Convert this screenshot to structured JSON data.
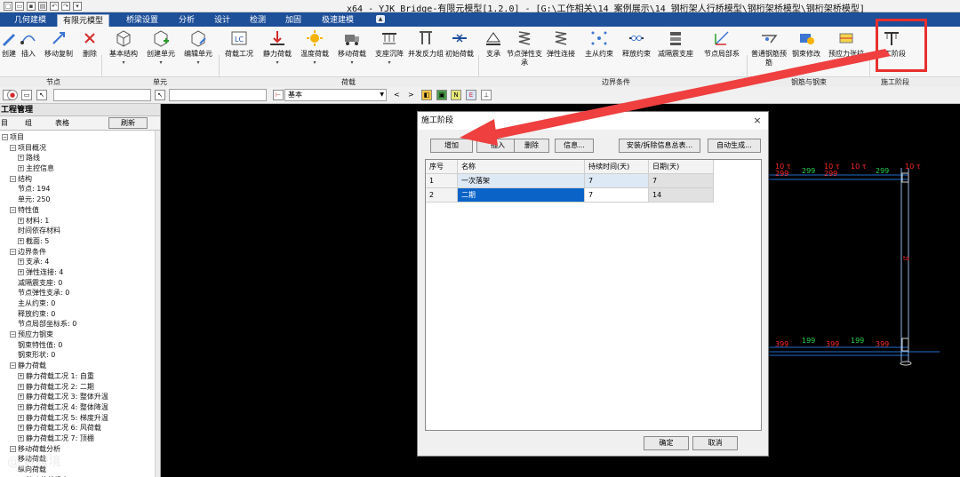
{
  "window": {
    "title": "x64 - YJK Bridge-有限元模型[1.2.0] - [G:\\工作相关\\14 案例展示\\14 钢桁架人行桥模型\\钢桁架桥模型\\钢桁架桥模型]"
  },
  "ribbon_tabs": [
    "几何建模",
    "有限元模型",
    "桥梁设置",
    "分析",
    "设计",
    "检测",
    "加固",
    "极速建模"
  ],
  "active_tab": "有限元模型",
  "ribbon": {
    "buttons": [
      {
        "label": "创建",
        "icon": "pencil-icon"
      },
      {
        "label": "插入",
        "icon": "node-insert-icon"
      },
      {
        "label": "移动复制",
        "icon": "move-copy-icon"
      },
      {
        "label": "删除",
        "icon": "delete-icon"
      },
      {
        "label": "基本结构",
        "icon": "cube-icon"
      },
      {
        "label": "创建单元",
        "icon": "cube-plus-icon"
      },
      {
        "label": "编辑单元",
        "icon": "cube-edit-icon"
      },
      {
        "label": "荷载工况",
        "icon": "lc-icon"
      },
      {
        "label": "静力荷载",
        "icon": "static-load-icon"
      },
      {
        "label": "温度荷载",
        "icon": "temperature-icon"
      },
      {
        "label": "移动荷载",
        "icon": "truck-icon"
      },
      {
        "label": "支座沉降",
        "icon": "support-settle-icon"
      },
      {
        "label": "并发反力组",
        "icon": "reaction-group-icon"
      },
      {
        "label": "初始荷载",
        "icon": "initial-load-icon"
      },
      {
        "label": "支承",
        "icon": "support-icon"
      },
      {
        "label": "节点弹性支承",
        "icon": "spring-icon"
      },
      {
        "label": "弹性连接",
        "icon": "elastic-link-icon"
      },
      {
        "label": "主从约束",
        "icon": "master-slave-icon"
      },
      {
        "label": "释放约束",
        "icon": "release-icon"
      },
      {
        "label": "减隔震支座",
        "icon": "isolator-icon"
      },
      {
        "label": "节点局部系",
        "icon": "local-axis-icon"
      },
      {
        "label": "普通钢筋预筋",
        "icon": "rebar-icon"
      },
      {
        "label": "钢束修改",
        "icon": "tendon-edit-icon"
      },
      {
        "label": "预应力张拉",
        "icon": "prestress-icon"
      },
      {
        "label": "施工阶段",
        "icon": "construction-stage-icon"
      }
    ],
    "groups": [
      "节点",
      "单元",
      "荷载",
      "边界条件",
      "钢筋与钢束",
      "施工阶段"
    ]
  },
  "toolbar": {
    "combo_value": "基本",
    "nav_prev": "<",
    "nav_next": ">"
  },
  "left_panel": {
    "title": "工程管理",
    "tabs": [
      "目",
      "组",
      "表格"
    ],
    "refresh_label": "刷新",
    "tree": [
      {
        "text": "项目",
        "level": 0,
        "box": "-"
      },
      {
        "text": "项目概况",
        "level": 1,
        "box": "-"
      },
      {
        "text": "路线",
        "level": 2,
        "box": "+"
      },
      {
        "text": "主控信息",
        "level": 2,
        "box": "+"
      },
      {
        "text": "结构",
        "level": 1,
        "box": "-"
      },
      {
        "text": "节点: 194",
        "level": 2,
        "box": ""
      },
      {
        "text": "单元: 250",
        "level": 2,
        "box": ""
      },
      {
        "text": "特性值",
        "level": 1,
        "box": "-"
      },
      {
        "text": "材料: 1",
        "level": 2,
        "box": "+"
      },
      {
        "text": "时间依存材料",
        "level": 2,
        "box": ""
      },
      {
        "text": "截面: 5",
        "level": 2,
        "box": "+"
      },
      {
        "text": "边界条件",
        "level": 1,
        "box": "-"
      },
      {
        "text": "支承: 4",
        "level": 2,
        "box": "+"
      },
      {
        "text": "弹性连接: 4",
        "level": 2,
        "box": "+"
      },
      {
        "text": "减隔震支座: 0",
        "level": 2,
        "box": ""
      },
      {
        "text": "节点弹性支承: 0",
        "level": 2,
        "box": ""
      },
      {
        "text": "主从约束: 0",
        "level": 2,
        "box": ""
      },
      {
        "text": "释放约束: 0",
        "level": 2,
        "box": ""
      },
      {
        "text": "节点局部坐标系: 0",
        "level": 2,
        "box": ""
      },
      {
        "text": "预应力钢束",
        "level": 1,
        "box": "-"
      },
      {
        "text": "钢束特性值: 0",
        "level": 2,
        "box": ""
      },
      {
        "text": "钢束形状: 0",
        "level": 2,
        "box": ""
      },
      {
        "text": "静力荷载",
        "level": 1,
        "box": "-"
      },
      {
        "text": "静力荷载工况 1: 自重",
        "level": 2,
        "box": "+"
      },
      {
        "text": "静力荷载工况 2: 二期",
        "level": 2,
        "box": "+"
      },
      {
        "text": "静力荷载工况 3: 整体升温",
        "level": 2,
        "box": "+"
      },
      {
        "text": "静力荷载工况 4: 整体降温",
        "level": 2,
        "box": "+"
      },
      {
        "text": "静力荷载工况 5: 梯度升温",
        "level": 2,
        "box": "+"
      },
      {
        "text": "静力荷载工况 6: 风荷载",
        "level": 2,
        "box": "+"
      },
      {
        "text": "静力荷载工况 7: 顶棚",
        "level": 2,
        "box": "+"
      },
      {
        "text": "移动荷载分析",
        "level": 1,
        "box": "-"
      },
      {
        "text": "移动荷载",
        "level": 2,
        "box": ""
      },
      {
        "text": "纵向荷载",
        "level": 2,
        "box": ""
      },
      {
        "text": "移动荷载组合",
        "level": 2,
        "box": "+"
      }
    ]
  },
  "dialog": {
    "title": "施工阶段",
    "close": "×",
    "buttons": [
      "增加",
      "插入",
      "删除",
      "信息...",
      "安装/拆除信息总表...",
      "自动生成..."
    ],
    "columns": [
      "序号",
      "名称",
      "持续时间(天)",
      "日期(天)"
    ],
    "rows": [
      {
        "no": "1",
        "name": "一次落架",
        "duration": "7",
        "date": "7"
      },
      {
        "no": "2",
        "name": "二期",
        "duration": "7",
        "date": "14"
      }
    ],
    "ok": "确定",
    "cancel": "取消"
  },
  "canvas": {
    "top_labels": [
      "10 τ",
      "299",
      "10 τ",
      "299",
      "10 τ"
    ],
    "bottom_labels": [
      "399",
      "199",
      "399",
      "399",
      "399"
    ],
    "side_label": "ta"
  },
  "watermark": "@ 数跨境",
  "colors": {
    "ribbon_tab_bg": "#1e4f99",
    "highlight": "#e8302e",
    "selection": "#0a64c8",
    "canvas_line": "#1f6fd0",
    "label_red": "#ff2a2a",
    "label_green": "#22d34a"
  }
}
